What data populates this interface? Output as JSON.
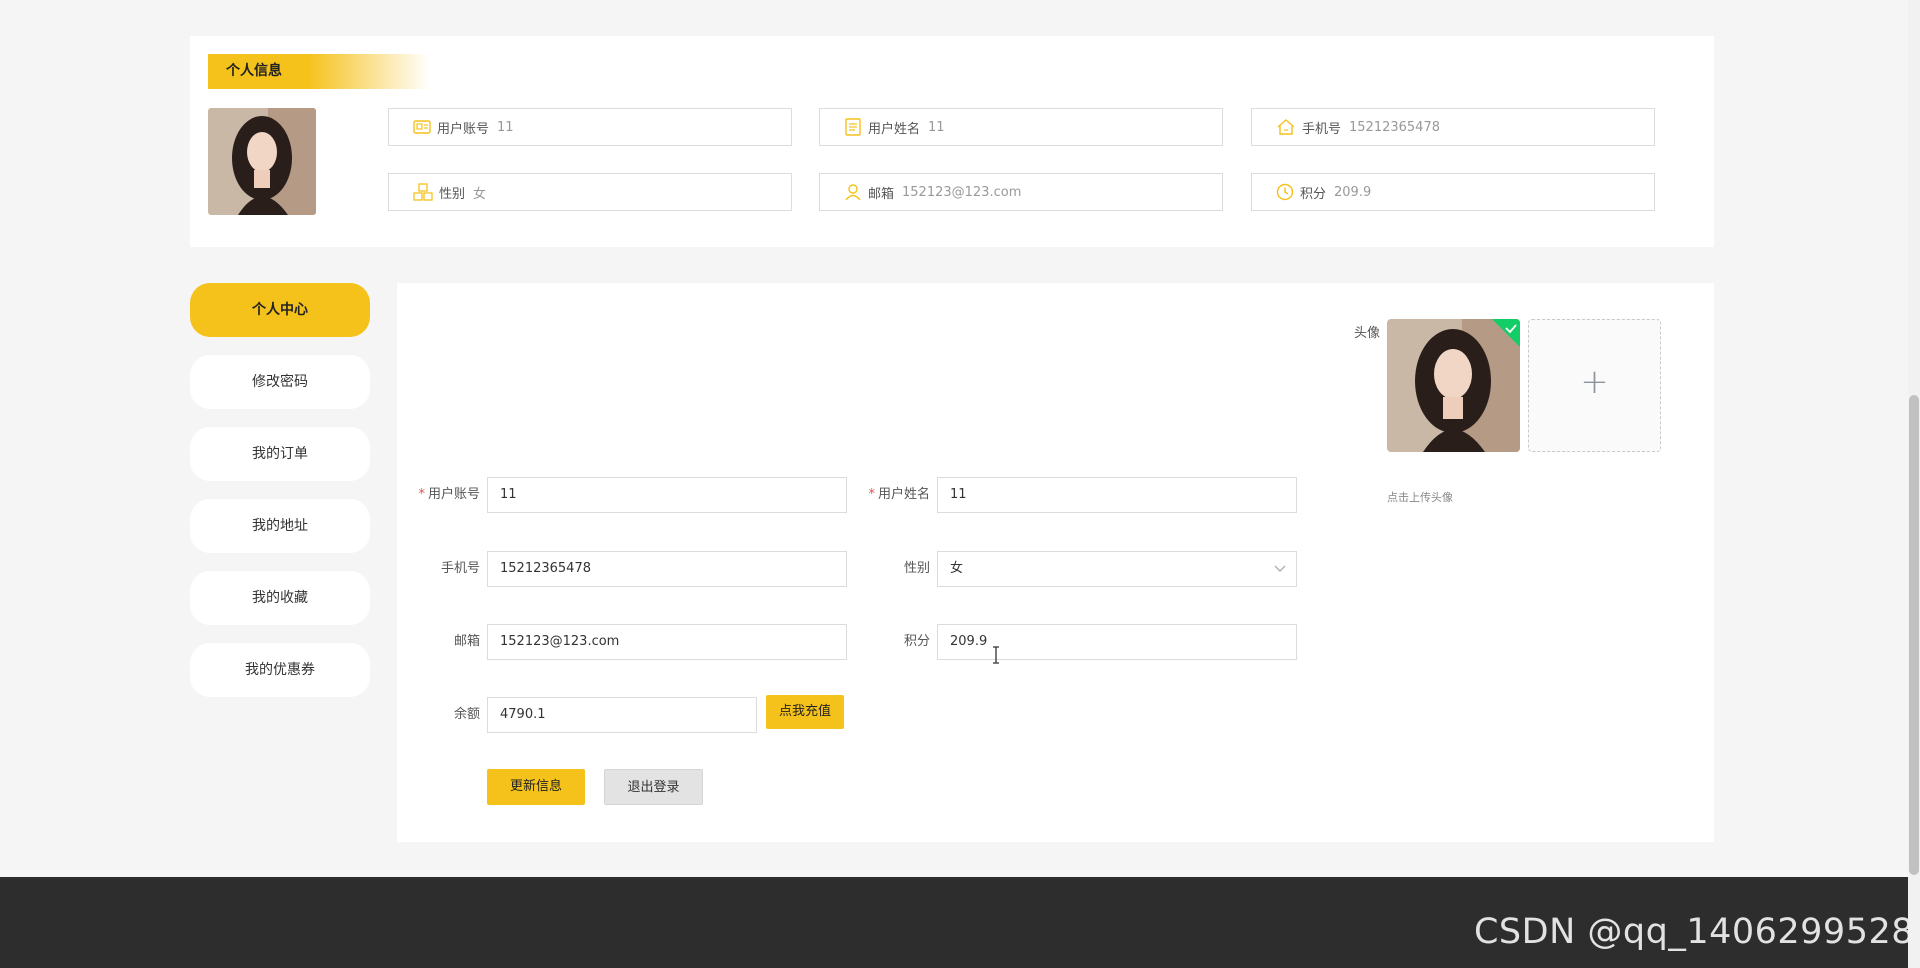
{
  "profile_card": {
    "title": "个人信息",
    "fields": [
      {
        "label": "用户账号",
        "value": "11",
        "icon": "id-card-icon"
      },
      {
        "label": "用户姓名",
        "value": "11",
        "icon": "document-icon"
      },
      {
        "label": "手机号",
        "value": "15212365478",
        "icon": "home-icon"
      },
      {
        "label": "性别",
        "value": "女",
        "icon": "cubes-icon"
      },
      {
        "label": "邮箱",
        "value": "152123@123.com",
        "icon": "user-icon"
      },
      {
        "label": "积分",
        "value": "209.9",
        "icon": "clock-icon"
      }
    ]
  },
  "sidebar": {
    "items": [
      {
        "label": "个人中心",
        "active": true
      },
      {
        "label": "修改密码"
      },
      {
        "label": "我的订单"
      },
      {
        "label": "我的地址"
      },
      {
        "label": "我的收藏"
      },
      {
        "label": "我的优惠券"
      }
    ]
  },
  "form": {
    "avatar_label": "头像",
    "upload_hint": "点击上传头像",
    "account_label": "用户账号",
    "account_value": "11",
    "name_label": "用户姓名",
    "name_value": "11",
    "phone_label": "手机号",
    "phone_value": "15212365478",
    "gender_label": "性别",
    "gender_value": "女",
    "email_label": "邮箱",
    "email_value": "152123@123.com",
    "points_label": "积分",
    "points_value": "209.9",
    "balance_label": "余额",
    "balance_value": "4790.1",
    "recharge_button": "点我充值",
    "update_button": "更新信息",
    "logout_button": "退出登录",
    "required_mark": "*",
    "upload_plus": "+"
  },
  "watermark": "CSDN @qq_1406299528",
  "colors": {
    "accent": "#f5c21b",
    "footer": "#2d2d2d",
    "success": "#13ce66"
  }
}
